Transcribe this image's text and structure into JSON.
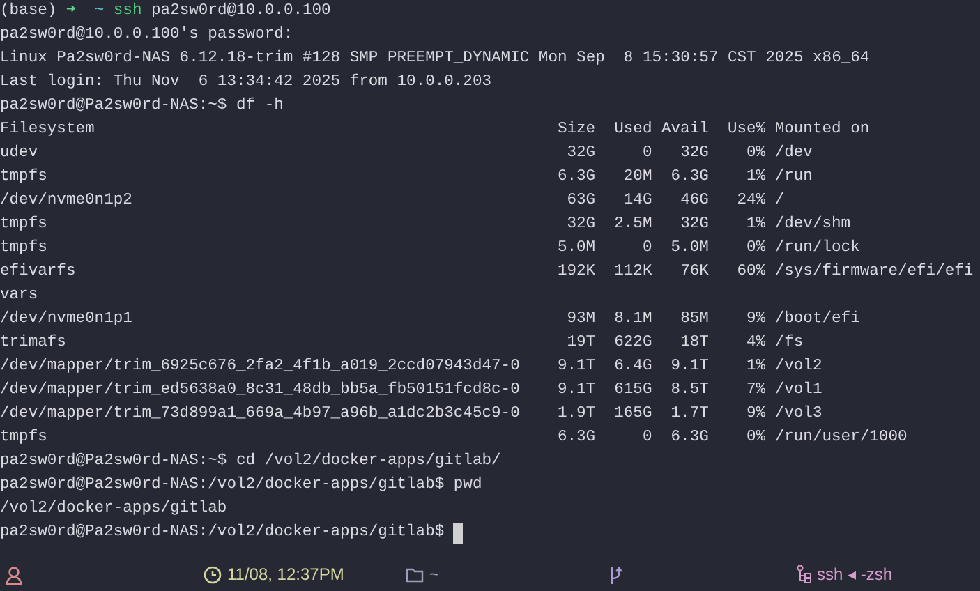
{
  "terminal": {
    "lines": [
      {
        "kind": "prompt",
        "env": "(base)",
        "arrow": "➜",
        "dir": "~",
        "command": "ssh",
        "args": "pa2sw0rd@10.0.0.100"
      },
      {
        "kind": "output",
        "text": "pa2sw0rd@10.0.0.100's password:"
      },
      {
        "kind": "output",
        "text": "Linux Pa2sw0rd-NAS 6.12.18-trim #128 SMP PREEMPT_DYNAMIC Mon Sep  8 15:30:57 CST 2025 x86_64"
      },
      {
        "kind": "output",
        "text": "Last login: Thu Nov  6 13:34:42 2025 from 10.0.0.203"
      },
      {
        "kind": "output",
        "text": "pa2sw0rd@Pa2sw0rd-NAS:~$ df -h"
      },
      {
        "kind": "table",
        "columns": [
          "Filesystem",
          "Size",
          "Used",
          "Avail",
          "Use%",
          "Mounted on"
        ],
        "rows": [
          [
            "udev",
            "32G",
            "0",
            "32G",
            "0%",
            "/dev"
          ],
          [
            "tmpfs",
            "6.3G",
            "20M",
            "6.3G",
            "1%",
            "/run"
          ],
          [
            "/dev/nvme0n1p2",
            "63G",
            "14G",
            "46G",
            "24%",
            "/"
          ],
          [
            "tmpfs",
            "32G",
            "2.5M",
            "32G",
            "1%",
            "/dev/shm"
          ],
          [
            "tmpfs",
            "5.0M",
            "0",
            "5.0M",
            "0%",
            "/run/lock"
          ],
          [
            "efivarfs",
            "192K",
            "112K",
            "76K",
            "60%",
            "/sys/firmware/efi/efi"
          ]
        ]
      },
      {
        "kind": "output",
        "text": "vars"
      },
      {
        "kind": "table",
        "rows": [
          [
            "/dev/nvme0n1p1",
            "93M",
            "8.1M",
            "85M",
            "9%",
            "/boot/efi"
          ],
          [
            "trimafs",
            "19T",
            "622G",
            "18T",
            "4%",
            "/fs"
          ],
          [
            "/dev/mapper/trim_6925c676_2fa2_4f1b_a019_2ccd07943d47-0",
            "9.1T",
            "6.4G",
            "9.1T",
            "1%",
            "/vol2"
          ],
          [
            "/dev/mapper/trim_ed5638a0_8c31_48db_bb5a_fb50151fcd8c-0",
            "9.1T",
            "615G",
            "8.5T",
            "7%",
            "/vol1"
          ],
          [
            "/dev/mapper/trim_73d899a1_669a_4b97_a96b_a1dc2b3c45c9-0",
            "1.9T",
            "165G",
            "1.7T",
            "9%",
            "/vol3"
          ],
          [
            "tmpfs",
            "6.3G",
            "0",
            "6.3G",
            "0%",
            "/run/user/1000"
          ]
        ]
      },
      {
        "kind": "output",
        "text": "pa2sw0rd@Pa2sw0rd-NAS:~$ cd /vol2/docker-apps/gitlab/"
      },
      {
        "kind": "output",
        "text": "pa2sw0rd@Pa2sw0rd-NAS:/vol2/docker-apps/gitlab$ pwd"
      },
      {
        "kind": "output",
        "text": "/vol2/docker-apps/gitlab"
      },
      {
        "kind": "output",
        "text": "pa2sw0rd@Pa2sw0rd-NAS:/vol2/docker-apps/gitlab$",
        "cursor": true
      }
    ]
  },
  "status_bar": {
    "time": "11/08, 12:37PM",
    "directory": "~",
    "process": "ssh ◂ -zsh"
  }
}
